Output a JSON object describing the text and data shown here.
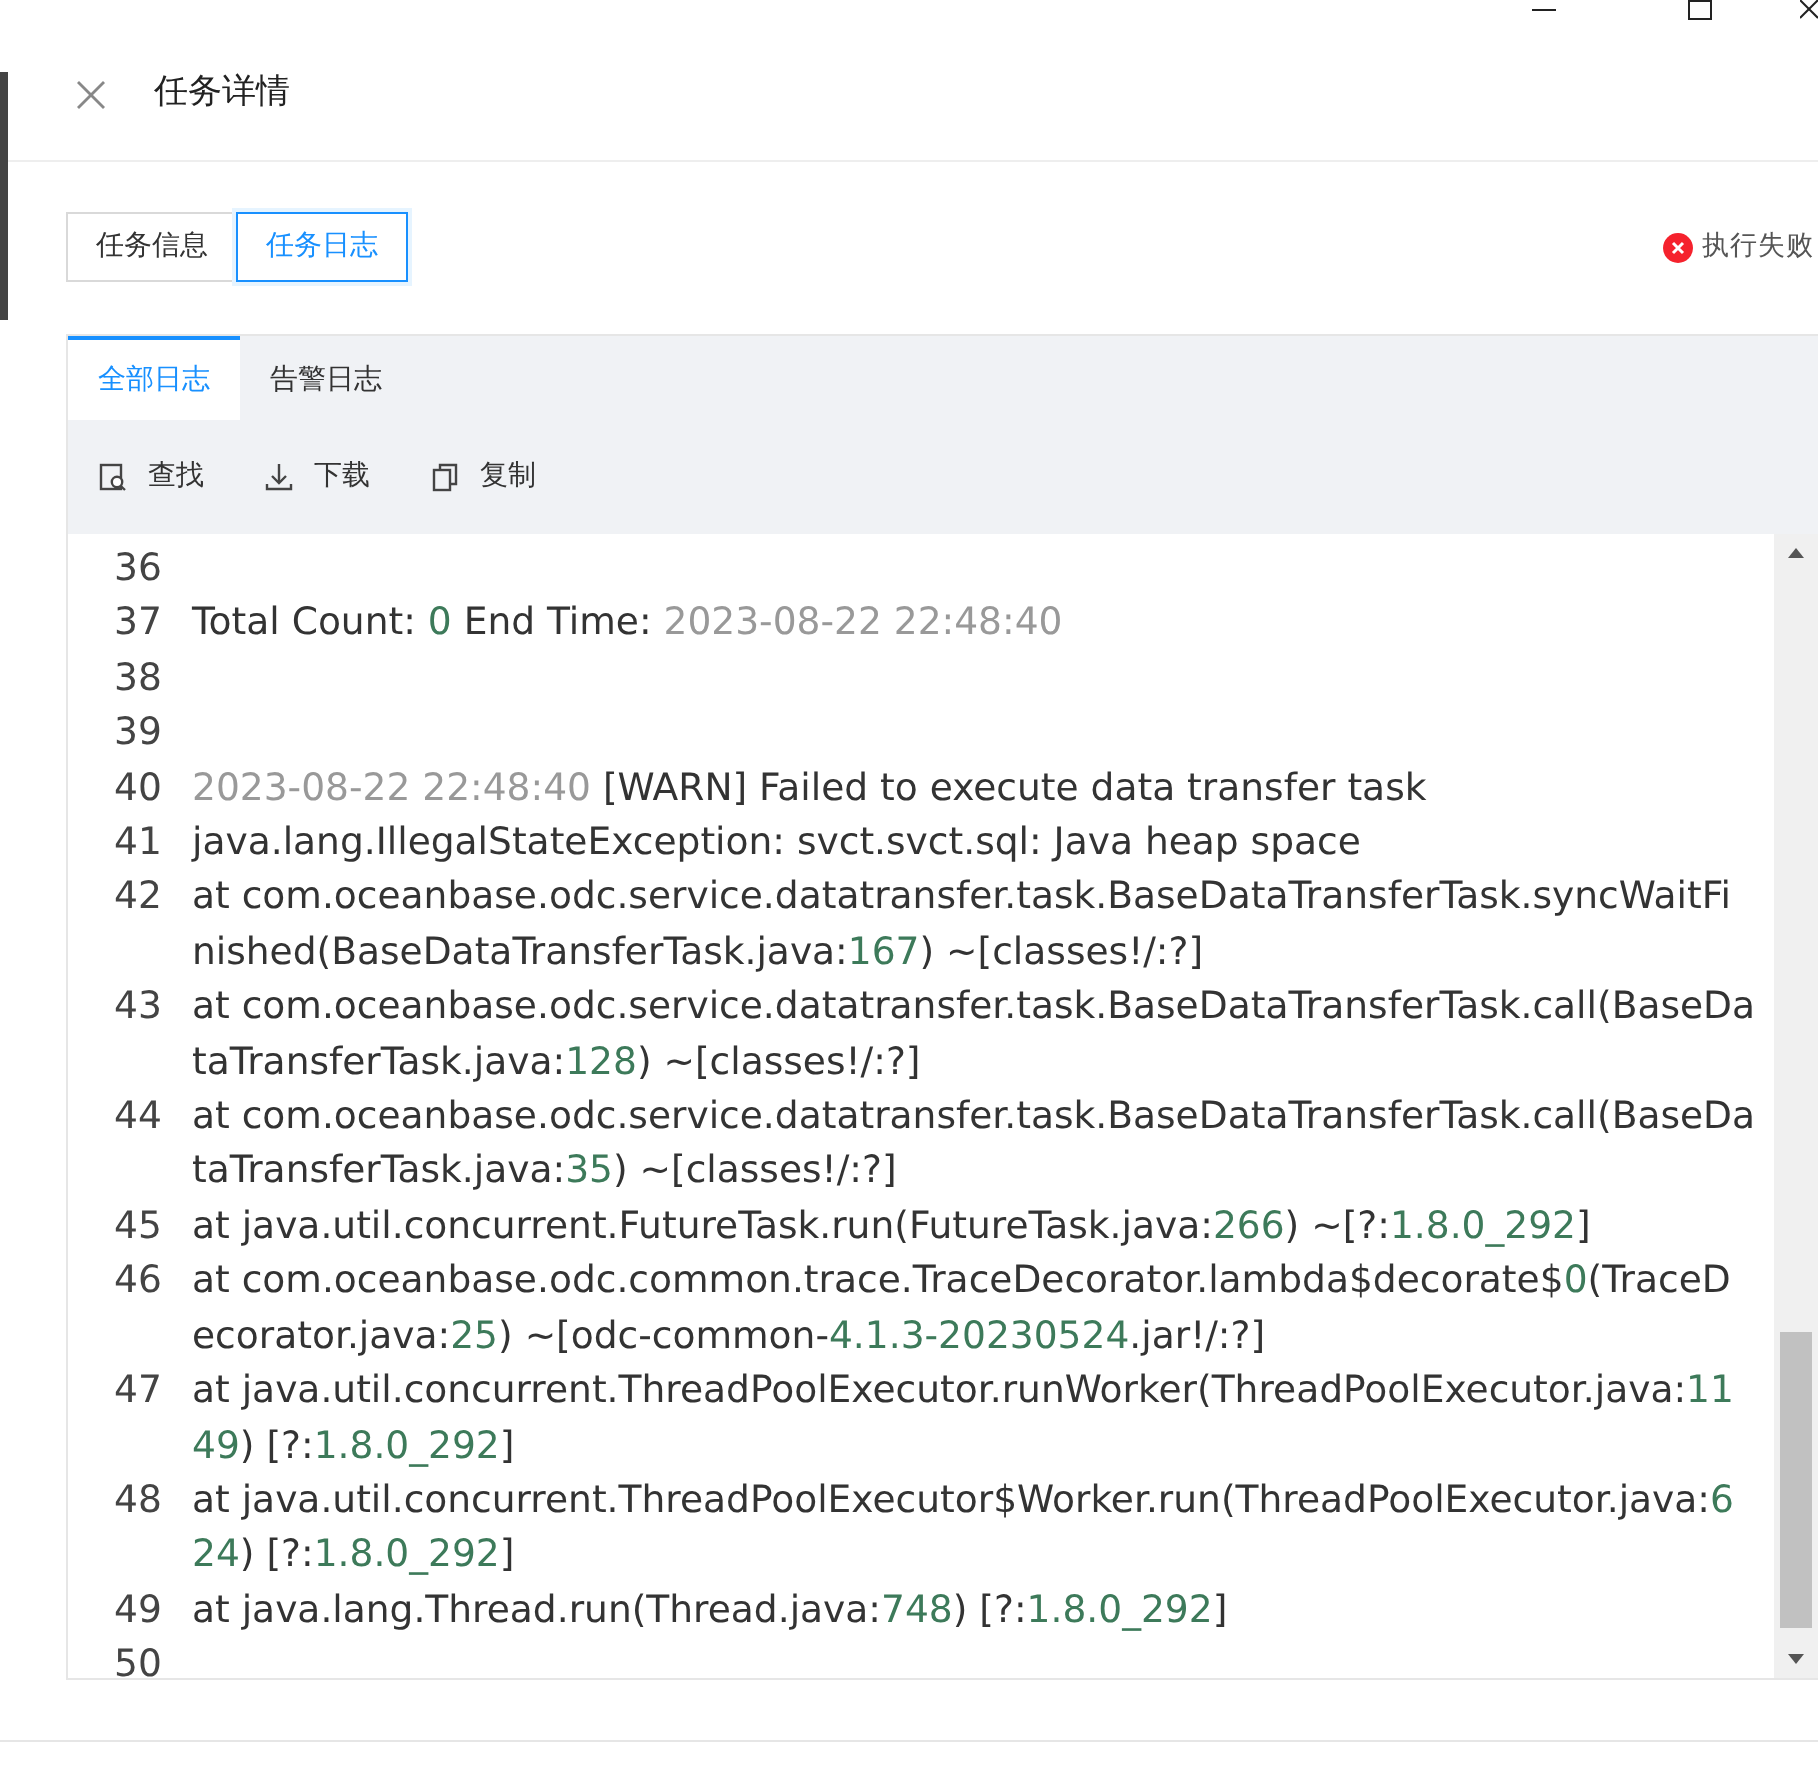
{
  "drawer": {
    "title": "任务详情"
  },
  "view_tabs": [
    {
      "label": "任务信息",
      "selected": false
    },
    {
      "label": "任务日志",
      "selected": true
    }
  ],
  "status": {
    "label": "执行失败",
    "kind": "error"
  },
  "log_tabs": [
    {
      "label": "全部日志",
      "selected": true
    },
    {
      "label": "告警日志",
      "selected": false
    }
  ],
  "toolbar": [
    {
      "label": "查找",
      "kind": "find"
    },
    {
      "label": "下载",
      "kind": "download"
    },
    {
      "label": "复制",
      "kind": "copy"
    }
  ],
  "log": {
    "lines": [
      {
        "number": "36"
      },
      {
        "number": "37",
        "rows": [
          {
            "spans": [
              {
                "text": "Total Count: ",
                "kind": "plain"
              },
              {
                "text": "0",
                "kind": "number"
              },
              {
                "text": " End Time: ",
                "kind": "plain"
              },
              {
                "text": "2023-08-22 22:48:40",
                "kind": "time"
              }
            ]
          }
        ]
      },
      {
        "number": "38"
      },
      {
        "number": "39"
      },
      {
        "number": "40",
        "rows": [
          {
            "spans": [
              {
                "text": "2023-08-22 22:48:40",
                "kind": "time"
              },
              {
                "text": " [WARN] Failed to execute data transfer task",
                "kind": "plain"
              }
            ]
          }
        ]
      },
      {
        "number": "41",
        "rows": [
          {
            "spans": [
              {
                "text": "java.lang.IllegalStateException: svct.svct.sql: Java heap space",
                "kind": "plain"
              }
            ]
          }
        ]
      },
      {
        "number": "42",
        "rows": [
          {
            "spans": [
              {
                "text": "at com.oceanbase.odc.service.datatransfer.task.BaseDataTransferTask.syncWaitFi",
                "kind": "plain"
              }
            ]
          },
          {
            "spans": [
              {
                "text": "nished(BaseDataTransferTask.java:",
                "kind": "plain"
              },
              {
                "text": "167",
                "kind": "number"
              },
              {
                "text": ") ~[classes!/:?]",
                "kind": "plain"
              }
            ]
          }
        ]
      },
      {
        "number": "43",
        "rows": [
          {
            "spans": [
              {
                "text": "at com.oceanbase.odc.service.datatransfer.task.BaseDataTransferTask.call(BaseDa",
                "kind": "plain"
              }
            ]
          },
          {
            "spans": [
              {
                "text": "taTransferTask.java:",
                "kind": "plain"
              },
              {
                "text": "128",
                "kind": "number"
              },
              {
                "text": ") ~[classes!/:?]",
                "kind": "plain"
              }
            ]
          }
        ]
      },
      {
        "number": "44",
        "rows": [
          {
            "spans": [
              {
                "text": "at com.oceanbase.odc.service.datatransfer.task.BaseDataTransferTask.call(BaseDa",
                "kind": "plain"
              }
            ]
          },
          {
            "spans": [
              {
                "text": "taTransferTask.java:",
                "kind": "plain"
              },
              {
                "text": "35",
                "kind": "number"
              },
              {
                "text": ") ~[classes!/:?]",
                "kind": "plain"
              }
            ]
          }
        ]
      },
      {
        "number": "45",
        "rows": [
          {
            "spans": [
              {
                "text": "at java.util.concurrent.FutureTask.run(FutureTask.java:",
                "kind": "plain"
              },
              {
                "text": "266",
                "kind": "number"
              },
              {
                "text": ") ~[?:",
                "kind": "plain"
              },
              {
                "text": "1.8.0_292",
                "kind": "number"
              },
              {
                "text": "]",
                "kind": "plain"
              }
            ]
          }
        ]
      },
      {
        "number": "46",
        "rows": [
          {
            "spans": [
              {
                "text": "at com.oceanbase.odc.common.trace.TraceDecorator.lambda$decorate$",
                "kind": "plain"
              },
              {
                "text": "0",
                "kind": "number"
              },
              {
                "text": "(TraceD",
                "kind": "plain"
              }
            ]
          },
          {
            "spans": [
              {
                "text": "ecorator.java:",
                "kind": "plain"
              },
              {
                "text": "25",
                "kind": "number"
              },
              {
                "text": ") ~[odc-common-",
                "kind": "plain"
              },
              {
                "text": "4.1.3-20230524",
                "kind": "number"
              },
              {
                "text": ".jar!/:?]",
                "kind": "plain"
              }
            ]
          }
        ]
      },
      {
        "number": "47",
        "rows": [
          {
            "spans": [
              {
                "text": "at java.util.concurrent.ThreadPoolExecutor.runWorker(ThreadPoolExecutor.java:",
                "kind": "plain"
              },
              {
                "text": "11",
                "kind": "number"
              }
            ]
          },
          {
            "spans": [
              {
                "text": "49",
                "kind": "number"
              },
              {
                "text": ") [?:",
                "kind": "plain"
              },
              {
                "text": "1.8.0_292",
                "kind": "number"
              },
              {
                "text": "]",
                "kind": "plain"
              }
            ]
          }
        ]
      },
      {
        "number": "48",
        "rows": [
          {
            "spans": [
              {
                "text": "at java.util.concurrent.ThreadPoolExecutor$Worker.run(ThreadPoolExecutor.java:",
                "kind": "plain"
              },
              {
                "text": "6",
                "kind": "number"
              }
            ]
          },
          {
            "spans": [
              {
                "text": "24",
                "kind": "number"
              },
              {
                "text": ") [?:",
                "kind": "plain"
              },
              {
                "text": "1.8.0_292",
                "kind": "number"
              },
              {
                "text": "]",
                "kind": "plain"
              }
            ]
          }
        ]
      },
      {
        "number": "49",
        "rows": [
          {
            "spans": [
              {
                "text": "at java.lang.Thread.run(Thread.java:",
                "kind": "plain"
              },
              {
                "text": "748",
                "kind": "number"
              },
              {
                "text": ") [?:",
                "kind": "plain"
              },
              {
                "text": "1.8.0_292",
                "kind": "number"
              },
              {
                "text": "]",
                "kind": "plain"
              }
            ]
          }
        ]
      },
      {
        "number": "50"
      }
    ]
  }
}
